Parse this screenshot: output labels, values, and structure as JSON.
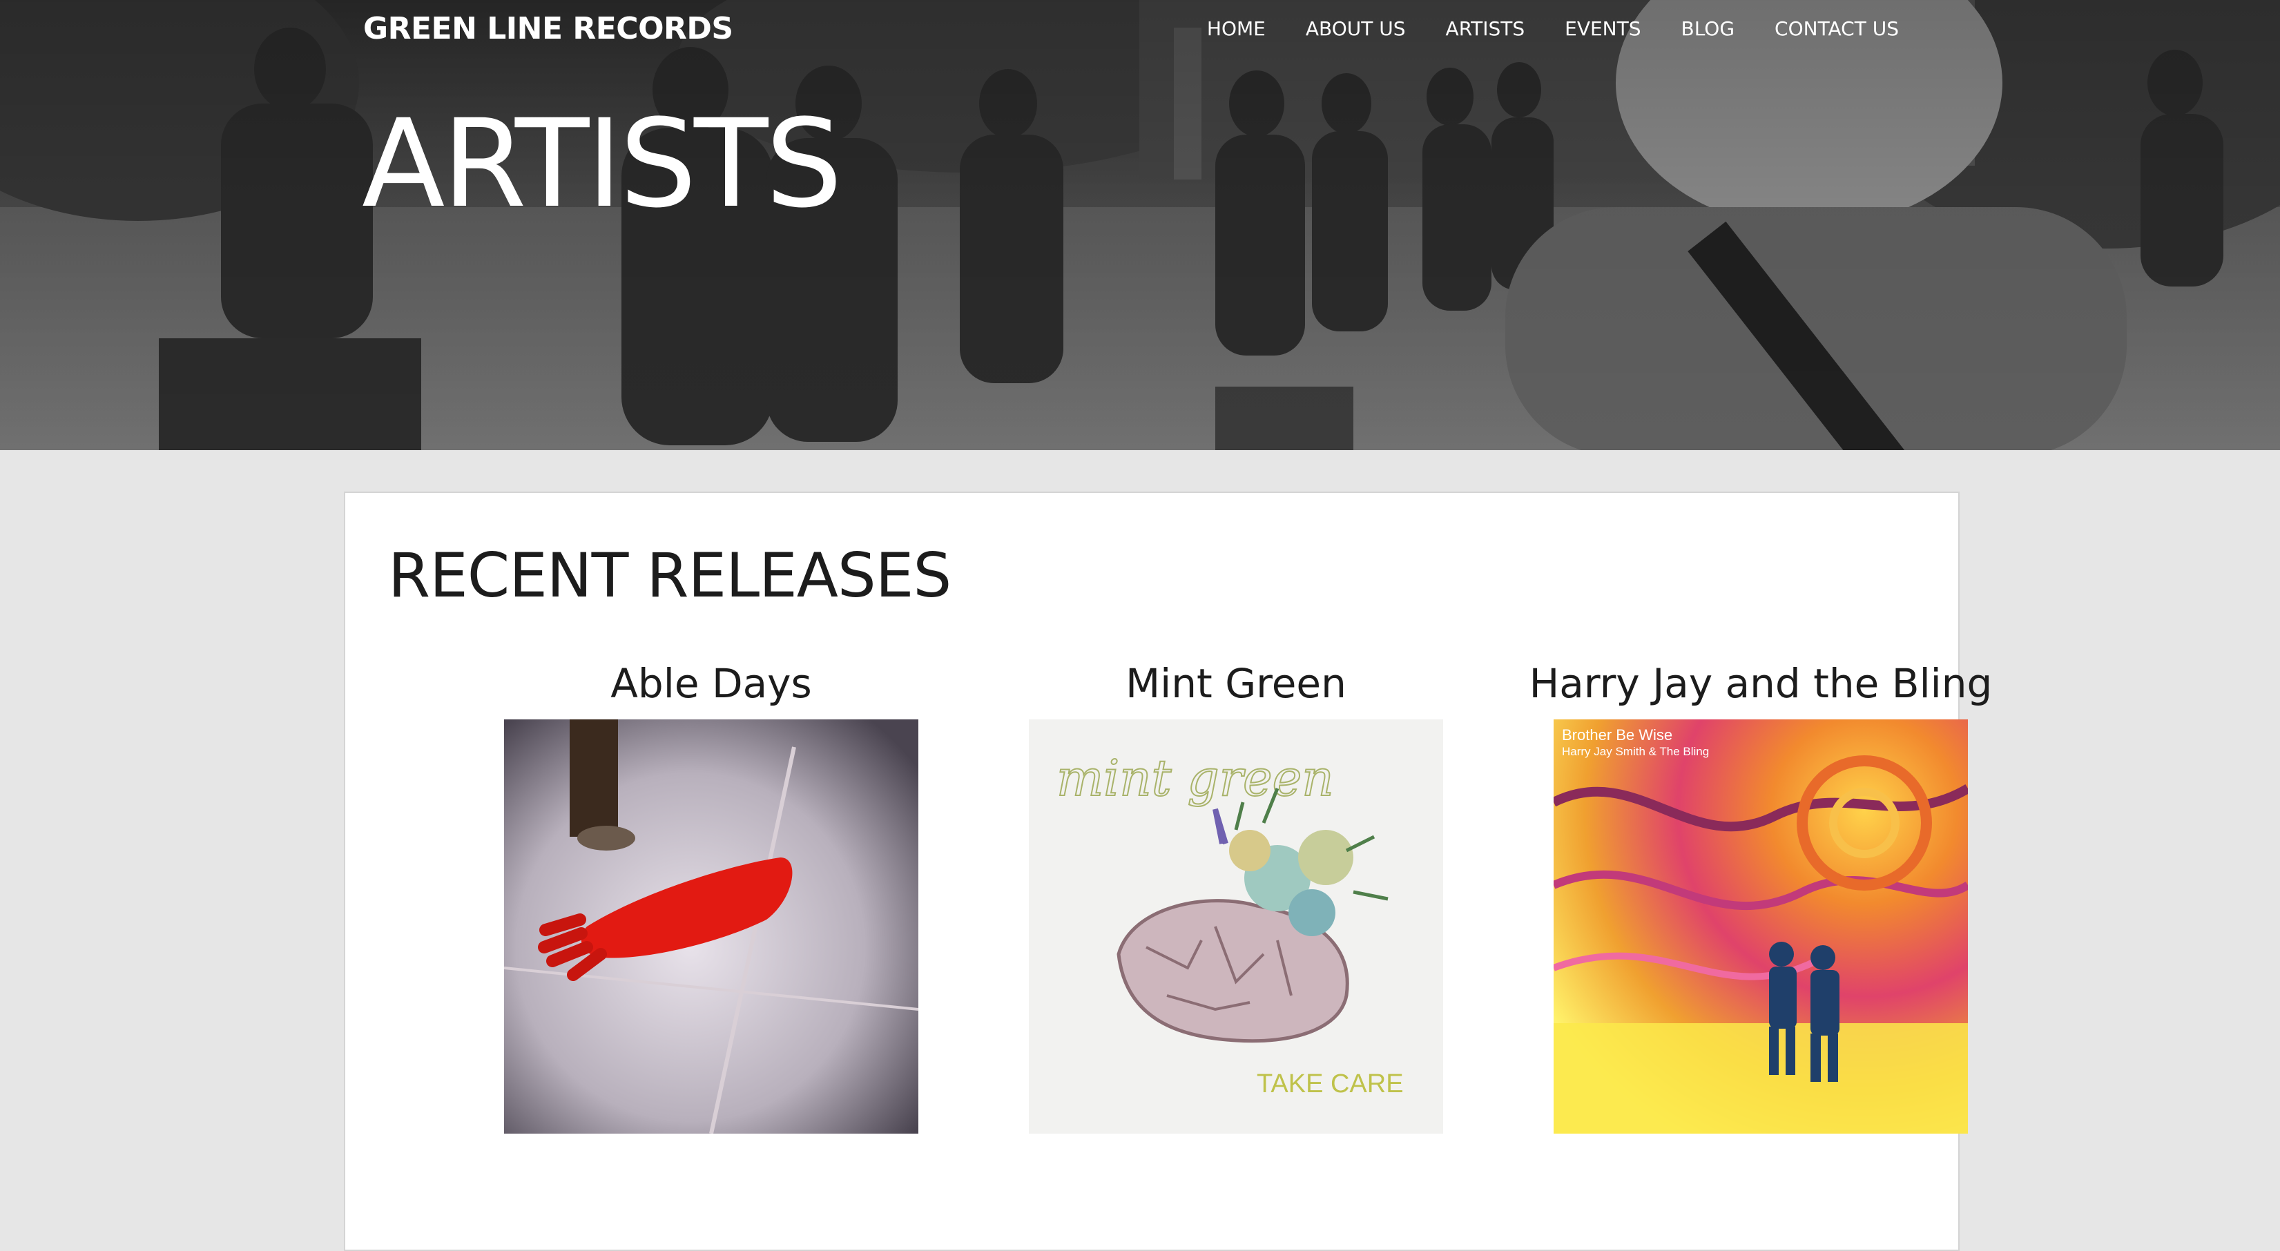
{
  "site": {
    "logo": "GREEN LINE RECORDS"
  },
  "nav": {
    "items": [
      "HOME",
      "ABOUT US",
      "ARTISTS",
      "EVENTS",
      "BLOG",
      "CONTACT US"
    ]
  },
  "hero": {
    "title": "ARTISTS"
  },
  "recent": {
    "title": "RECENT RELEASES",
    "releases": [
      {
        "artist": "Able Days"
      },
      {
        "artist": "Mint Green",
        "cover_script": "mint green",
        "cover_caption": "TAKE CARE"
      },
      {
        "artist": "Harry Jay and the Bling",
        "cover_line1": "Brother Be Wise",
        "cover_line2": "Harry Jay Smith & The Bling"
      }
    ]
  },
  "colors": {
    "background": "#e6e6e6",
    "card": "#ffffff",
    "text": "#1c1c1c",
    "hero_text": "#ffffff"
  }
}
